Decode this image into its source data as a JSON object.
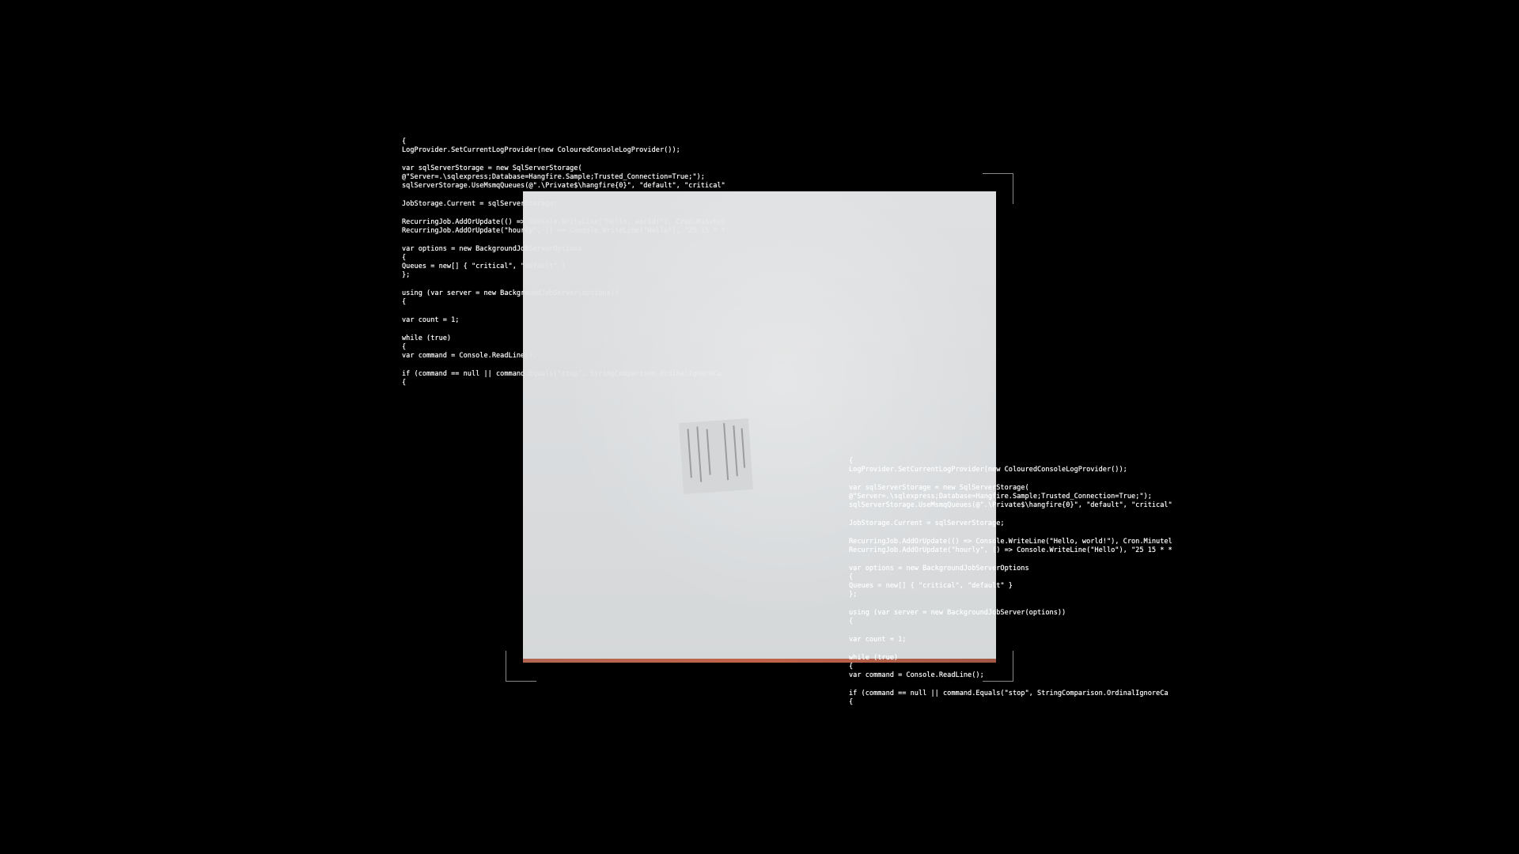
{
  "code_left": {
    "lines": [
      "{",
      "LogProvider.SetCurrentLogProvider(new ColouredConsoleLogProvider());",
      "",
      "var sqlServerStorage = new SqlServerStorage(",
      "@\"Server=.\\sqlexpress;Database=Hangfire.Sample;Trusted_Connection=True;\");",
      "sqlServerStorage.UseMsmqQueues(@\".\\Private$\\hangfire{0}\", \"default\", \"critical\"",
      "",
      "JobStorage.Current = sqlServerStorage;",
      "",
      "RecurringJob.AddOrUpdate(() => Console.WriteLine(\"Hello, world!\"), Cron.Minutel",
      "RecurringJob.AddOrUpdate(\"hourly\", () => Console.WriteLine(\"Hello\"), \"25 15 * *",
      "",
      "var options = new BackgroundJobServerOptions",
      "{",
      "Queues = new[] { \"critical\", \"default\" }",
      "};",
      "",
      "using (var server = new BackgroundJobServer(options))",
      "{",
      "",
      "var count = 1;",
      "",
      "while (true)",
      "{",
      "var command = Console.ReadLine();",
      "",
      "if (command == null || command.Equals(\"stop\", StringComparison.OrdinalIgnoreCa",
      "{"
    ]
  },
  "code_right": {
    "lines": [
      "{",
      "LogProvider.SetCurrentLogProvider(new ColouredConsoleLogProvider());",
      "",
      "var sqlServerStorage = new SqlServerStorage(",
      "@\"Server=.\\sqlexpress;Database=Hangfire.Sample;Trusted_Connection=True;\");",
      "sqlServerStorage.UseMsmqQueues(@\".\\Private$\\hangfire{0}\", \"default\", \"critical\"",
      "",
      "JobStorage.Current = sqlServerStorage;",
      "",
      "RecurringJob.AddOrUpdate(() => Console.WriteLine(\"Hello, world!\"), Cron.Minutel",
      "RecurringJob.AddOrUpdate(\"hourly\", () => Console.WriteLine(\"Hello\"), \"25 15 * *",
      "",
      "var options = new BackgroundJobServerOptions",
      "{",
      "Queues = new[] { \"critical\", \"default\" }",
      "};",
      "",
      "using (var server = new BackgroundJobServer(options))",
      "{",
      "",
      "var count = 1;",
      "",
      "while (true)",
      "{",
      "var command = Console.ReadLine();",
      "",
      "if (command == null || command.Equals(\"stop\", StringComparison.OrdinalIgnoreCa",
      "{"
    ]
  },
  "colors": {
    "background": "#000000",
    "code_text": "#ffffff",
    "frame_corner": "#8a8a8a",
    "preview_fill": "#e3e5e7",
    "preview_bottom_edge": "#c7664c"
  }
}
